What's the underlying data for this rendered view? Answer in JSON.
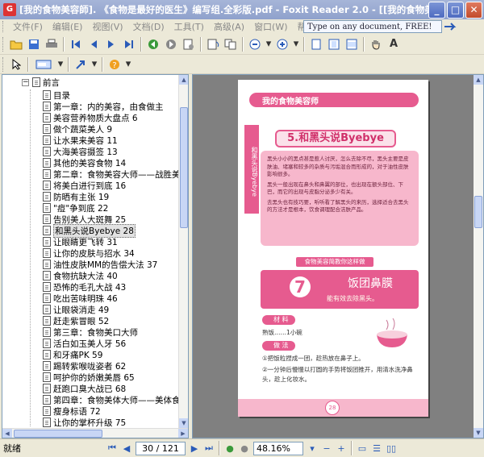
{
  "window": {
    "title": "[我的食物美容師]. 《食物是最好的医生》编写组.全彩版.pdf - Foxit Reader 2.0 - [[我的食物美..."
  },
  "menu": [
    "文件(F)",
    "编辑(E)",
    "视图(V)",
    "文档(D)",
    "工具(T)",
    "高级(A)",
    "窗口(W)",
    "帮助(H)"
  ],
  "ad": {
    "text": "Type on any document, FREE!"
  },
  "outline": {
    "root": "前言",
    "items": [
      {
        "label": "目录",
        "level": 2
      },
      {
        "label": "第一章：内的美容，由食做主",
        "level": 1
      },
      {
        "label": "美容营养物质大盘点    6",
        "level": 2
      },
      {
        "label": "做个蔬菜美人    9",
        "level": 2
      },
      {
        "label": "让水果来美容    11",
        "level": 2
      },
      {
        "label": "大海美容摄签    13",
        "level": 2
      },
      {
        "label": "其他的美容食物    14",
        "level": 2
      },
      {
        "label": "第二章：食物美容大师——战胜美容大",
        "level": 1
      },
      {
        "label": "将美白进行到底    16",
        "level": 2
      },
      {
        "label": "防晒有主张    19",
        "level": 2
      },
      {
        "label": "\"痘\"争到底    22",
        "level": 2
      },
      {
        "label": "告别美人大斑舞    25",
        "level": 2
      },
      {
        "label": "和黑头说Byebye    28",
        "level": 2
      },
      {
        "label": "让眼睛更飞转    31",
        "level": 2
      },
      {
        "label": "让你的皮肤与招水    34",
        "level": 2
      },
      {
        "label": "油性皮肤MM的告偿大法    37",
        "level": 2
      },
      {
        "label": "食物抗缺大法    40",
        "level": 2
      },
      {
        "label": "恐怖的毛孔大战    43",
        "level": 2
      },
      {
        "label": "吃出苦味明珠    46",
        "level": 2
      },
      {
        "label": "让眼袋消走    49",
        "level": 2
      },
      {
        "label": "赶走紫冒眼    52",
        "level": 2
      },
      {
        "label": "第三章：食物美口大师",
        "level": 1
      },
      {
        "label": "活白如玉美人牙    56",
        "level": 2
      },
      {
        "label": "和牙痛PK    59",
        "level": 2
      },
      {
        "label": "踢转紫喉咙姿者    62",
        "level": 2
      },
      {
        "label": "呵护你的娇嫩美唇    65",
        "level": 2
      },
      {
        "label": "赶跑口臭大战已    68",
        "level": 2
      },
      {
        "label": "第四章：食物美体大师——美体食物+",
        "level": 1
      },
      {
        "label": "瘦身标语    72",
        "level": 2
      },
      {
        "label": "让你的掌杯升级    75",
        "level": 2
      },
      {
        "label": "...",
        "level": 2
      }
    ],
    "selected_index": 12
  },
  "page_content": {
    "header": "我的食物美容师",
    "side": "和黑头说Byebye",
    "title": "5.和黑头说Byebye",
    "paragraphs": [
      "黑头小小的黑点甚是惹人讨厌，怎么去除不尽，黑头主要是皮肤油、堵塞和较多的杂质与污垢混合而形成的，对于油性皮肤影响很多。",
      "黑头一般出现在鼻头和鼻翼的部位，也出现在额头部位、下巴，而它的出现与皮脂分泌多少有关。",
      "去黑头也有技巧要，听听看了解黑头的来历，选择适合去黑头的方法才是根本，饮食调理配合洁肤产品。"
    ],
    "banner": "食物美容简教你这样做",
    "recipe_num": "7",
    "recipe_title": "饭团鼻膜",
    "recipe_sub": "能有效去除黑头。",
    "label_material": "材 料",
    "material": "熟饭……1小碗",
    "label_method": "做 法",
    "steps": [
      "①把饭粒捏成一团，趁热放在鼻子上。",
      "②一分钟后慢慢以打圆的手势将饭团推开，用清水洗净鼻头，趁上化妆水。"
    ],
    "page_num": "28"
  },
  "status": {
    "text": "就绪",
    "page_display": "30 / 121",
    "zoom": "48.16%"
  },
  "colors": {
    "accent": "#e65b8f",
    "titlebar": "#8fa1cc"
  }
}
